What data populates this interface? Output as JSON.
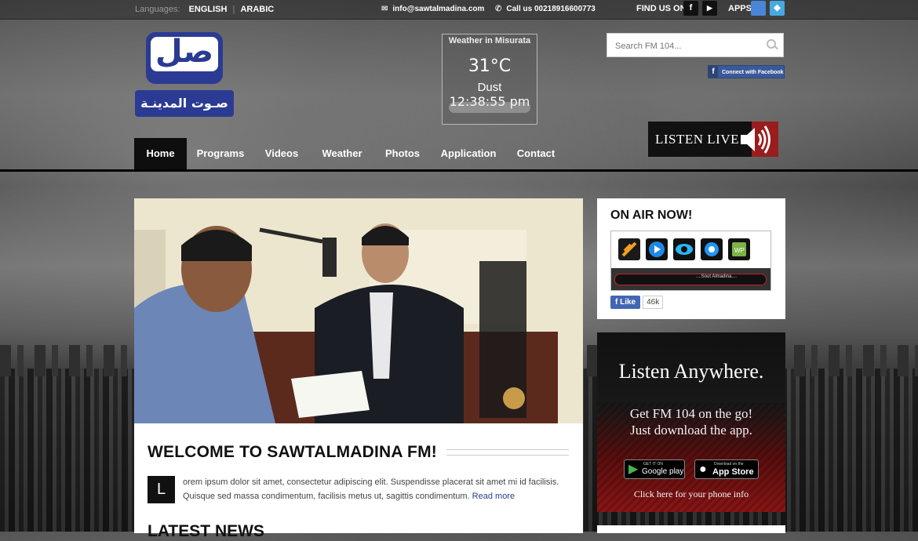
{
  "topbar": {
    "languages_label": "Languages:",
    "lang_english": "ENGLISH",
    "lang_arabic": "ARABIC",
    "email": "info@sawtalmadina.com",
    "phone": "Call us 00218916600773",
    "find_us": "FIND US ON",
    "apps": "APPS"
  },
  "logo": {
    "mark": "صل",
    "wordmark": "صـوت المدينـة"
  },
  "weather": {
    "title": "Weather in Misurata",
    "temperature": "31°C",
    "condition": "Dust",
    "time": "12:38:55 pm"
  },
  "search": {
    "placeholder": "Search FM 104..."
  },
  "facebook_connect": "Connect with Facebook",
  "listen_live": "LISTEN LIVE",
  "nav": {
    "items": [
      "Home",
      "Programs",
      "Videos",
      "Weather",
      "Photos",
      "Application",
      "Contact"
    ],
    "active": "Home"
  },
  "welcome": {
    "title": "WELCOME TO SAWTALMADINA FM!",
    "drop_cap": "L",
    "body": "orem ipsum dolor sit amet, consectetur adipiscing elit. Suspendisse placerat sit amet mi id facilisis. Quisque sed massa condimentum, facilisis metus ut, sagittis condimentum.",
    "read_more": "Read more",
    "latest_news": "LATEST NEWS"
  },
  "onair": {
    "title": "ON AIR NOW!",
    "player_name": "....Sout Almadina....",
    "like_label": "Like",
    "like_count": "46k"
  },
  "anywhere": {
    "heading": "Listen Anywhere.",
    "line1": "Get FM 104 on the go!",
    "line2": "Just download the app.",
    "google_small": "GET IT ON",
    "google_big": "Google play",
    "apple_small": "Download on the",
    "apple_big": "App Store",
    "click": "Click here for your phone info"
  },
  "colors": {
    "brand_blue": "#2b3b93",
    "listen_red": "#9a1c1c",
    "facebook": "#3b5998"
  }
}
